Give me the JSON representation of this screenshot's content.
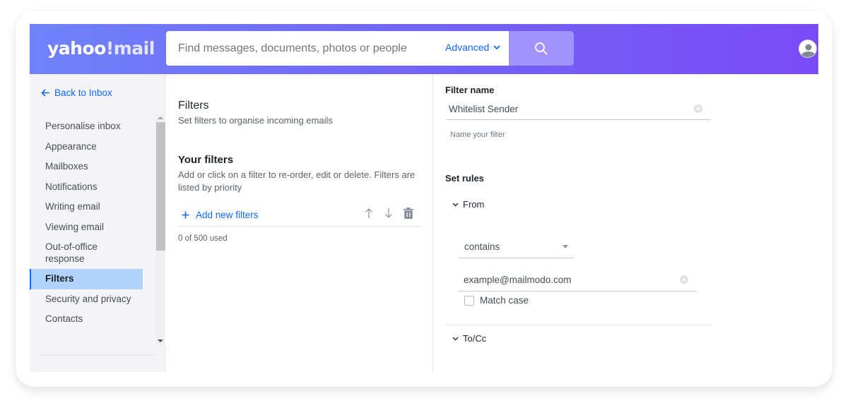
{
  "colors": {
    "accent": "#0f69ff",
    "header_start": "#7082f9",
    "header_end": "#7a4bf7",
    "search_button": "#a193fb",
    "active_item_bg": "#b0d2fb"
  },
  "header": {
    "logo_text_yahoo": "yahoo",
    "logo_text_bang": "!",
    "logo_text_mail": "mail",
    "search_placeholder": "Find messages, documents, photos or people",
    "advanced_label": "Advanced",
    "search_icon": "search-icon",
    "avatar_icon": "user-avatar-icon"
  },
  "sidebar": {
    "back_label": "Back to Inbox",
    "items": [
      {
        "label": "Personalise inbox",
        "active": false
      },
      {
        "label": "Appearance",
        "active": false
      },
      {
        "label": "Mailboxes",
        "active": false
      },
      {
        "label": "Notifications",
        "active": false
      },
      {
        "label": "Writing email",
        "active": false
      },
      {
        "label": "Viewing email",
        "active": false
      },
      {
        "label": "Out-of-office response",
        "active": false
      },
      {
        "label": "Filters",
        "active": true
      },
      {
        "label": "Security and privacy",
        "active": false
      },
      {
        "label": "Contacts",
        "active": false
      }
    ]
  },
  "filters_panel": {
    "title": "Filters",
    "subtitle": "Set filters to organise incoming emails",
    "your_filters_heading": "Your filters",
    "your_filters_desc": "Add or click on a filter to re-order, edit or delete. Filters are listed by priority",
    "add_label": "Add new filters",
    "used_count": "0 of 500 used"
  },
  "filter_editor": {
    "filter_name_label": "Filter name",
    "filter_name_value": "Whitelist Sender",
    "filter_name_helper": "Name your filter",
    "set_rules_label": "Set rules",
    "from_section": {
      "label": "From",
      "condition_selected": "contains",
      "value": "example@mailmodo.com",
      "match_case_label": "Match case",
      "match_case_checked": false
    },
    "to_cc_section": {
      "label": "To/Cc"
    }
  }
}
